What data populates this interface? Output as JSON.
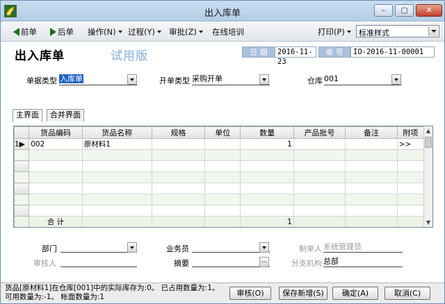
{
  "window": {
    "title": "出入库单"
  },
  "toolbar": {
    "prev": "前单",
    "next": "后单",
    "operate": "操作(N)",
    "process": "过程(Y)",
    "approve": "审批(Z)",
    "training": "在线培训",
    "print": "打印(P)",
    "print_style": "标准样式"
  },
  "form": {
    "heading": "出入库单",
    "trial": "试用版",
    "date_label": "日 期",
    "date_value": "2016-11-23",
    "number_label": "单 号",
    "number_value": "IO-2016-11-00001",
    "doc_type_label": "单据类型",
    "doc_type_value": "入库单",
    "open_type_label": "开单类型",
    "open_type_value": "采购开单",
    "warehouse_label": "仓库",
    "warehouse_value": "001"
  },
  "tabs": [
    "主界面",
    "合并界面"
  ],
  "grid": {
    "columns": [
      "货品编码",
      "货品名称",
      "规格",
      "单位",
      "数量",
      "产品批号",
      "备注",
      "附项"
    ],
    "rows": [
      {
        "index": "1",
        "code": "002",
        "name": "原材料1",
        "spec": "",
        "unit": "",
        "qty": "1",
        "batch": "",
        "note": "",
        "extra": ">>"
      }
    ],
    "total_label": "合 计",
    "total_qty": "1"
  },
  "footer": {
    "dept_label": "部门",
    "dept_value": "",
    "staff_label": "业务员",
    "staff_value": "",
    "maker_label": "制单人",
    "maker_value": "系统管理员",
    "auditor_label": "审核人",
    "auditor_value": "",
    "summary_label": "摘要",
    "summary_value": "",
    "branch_label": "分支机构",
    "branch_value": "总部"
  },
  "status": {
    "message": "货品[原材料1]在仓库[001]中的实际库存为:0。 已占用数量为:1。 可用数量为:-1。 帐面数量为:1"
  },
  "buttons": {
    "audit": "审核(O)",
    "save_new": "保存新增(S)",
    "ok": "确定(A)",
    "cancel": "取消(C)"
  }
}
